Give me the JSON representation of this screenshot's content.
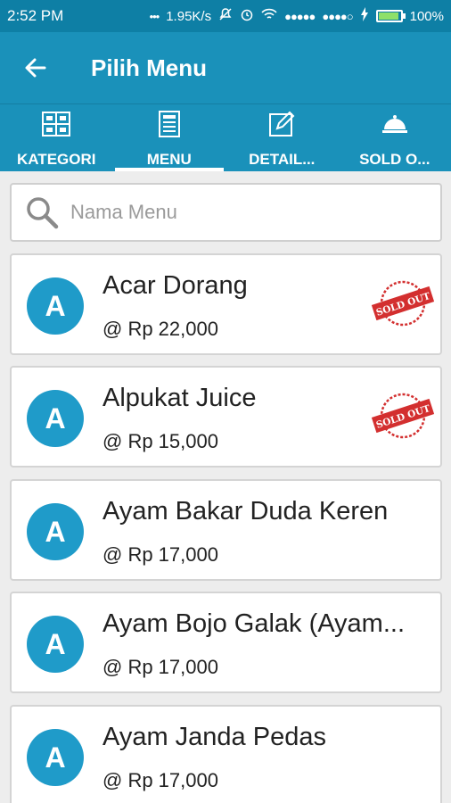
{
  "status": {
    "time": "2:52 PM",
    "network_speed": "1.95K/s",
    "battery": "100%"
  },
  "appbar": {
    "title": "Pilih Menu"
  },
  "tabs": [
    {
      "label": "KATEGORI",
      "icon": "grid-icon"
    },
    {
      "label": "MENU",
      "icon": "menu-book-icon"
    },
    {
      "label": "DETAIL...",
      "icon": "edit-icon"
    },
    {
      "label": "SOLD O...",
      "icon": "cloche-icon"
    }
  ],
  "active_tab": "MENU",
  "search": {
    "placeholder": "Nama Menu",
    "value": ""
  },
  "items": [
    {
      "initial": "A",
      "name": "Acar Dorang",
      "price": "@ Rp 22,000",
      "sold_out": true
    },
    {
      "initial": "A",
      "name": "Alpukat Juice",
      "price": "@ Rp 15,000",
      "sold_out": true
    },
    {
      "initial": "A",
      "name": "Ayam Bakar Duda Keren",
      "price": "@ Rp 17,000",
      "sold_out": false
    },
    {
      "initial": "A",
      "name": "Ayam Bojo Galak (Ayam...",
      "price": "@ Rp 17,000",
      "sold_out": false
    },
    {
      "initial": "A",
      "name": "Ayam Janda Pedas",
      "price": "@ Rp 17,000",
      "sold_out": false
    }
  ],
  "sold_out_stamp": "SOLD OUT",
  "colors": {
    "primary": "#1a91ba",
    "status_bar": "#0e7fa5",
    "avatar": "#1f9bc9",
    "stamp": "#d32f2f"
  }
}
